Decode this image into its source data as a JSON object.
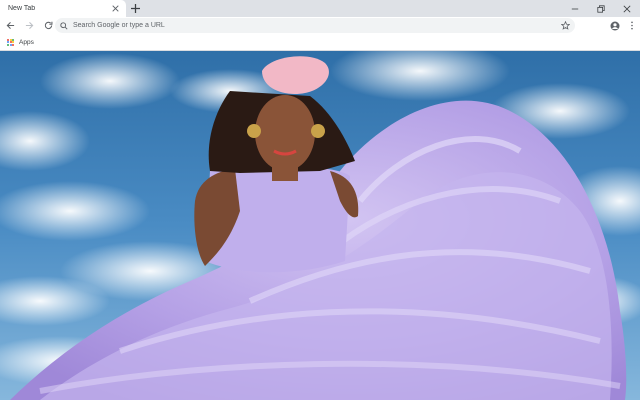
{
  "browser": {
    "tab_title": "New Tab",
    "new_tab_symbol": "+",
    "omnibox_placeholder": "Search Google or type a URL",
    "bookmarks": [
      {
        "label": "Apps",
        "icon": "apps-grid-icon"
      }
    ],
    "window_controls": [
      "minimize-icon",
      "restore-icon",
      "close-icon"
    ]
  },
  "colors": {
    "tab_bar": "#dee1e6",
    "toolbar": "#ffffff",
    "omnibox": "#f1f3f4",
    "sky": "#4a8cc4",
    "dress": "#b8a6e6",
    "headwrap": "#f2b8c6"
  },
  "background_image": {
    "subject": "woman in voluminous lavender tulle gown against cloudy blue sky"
  }
}
